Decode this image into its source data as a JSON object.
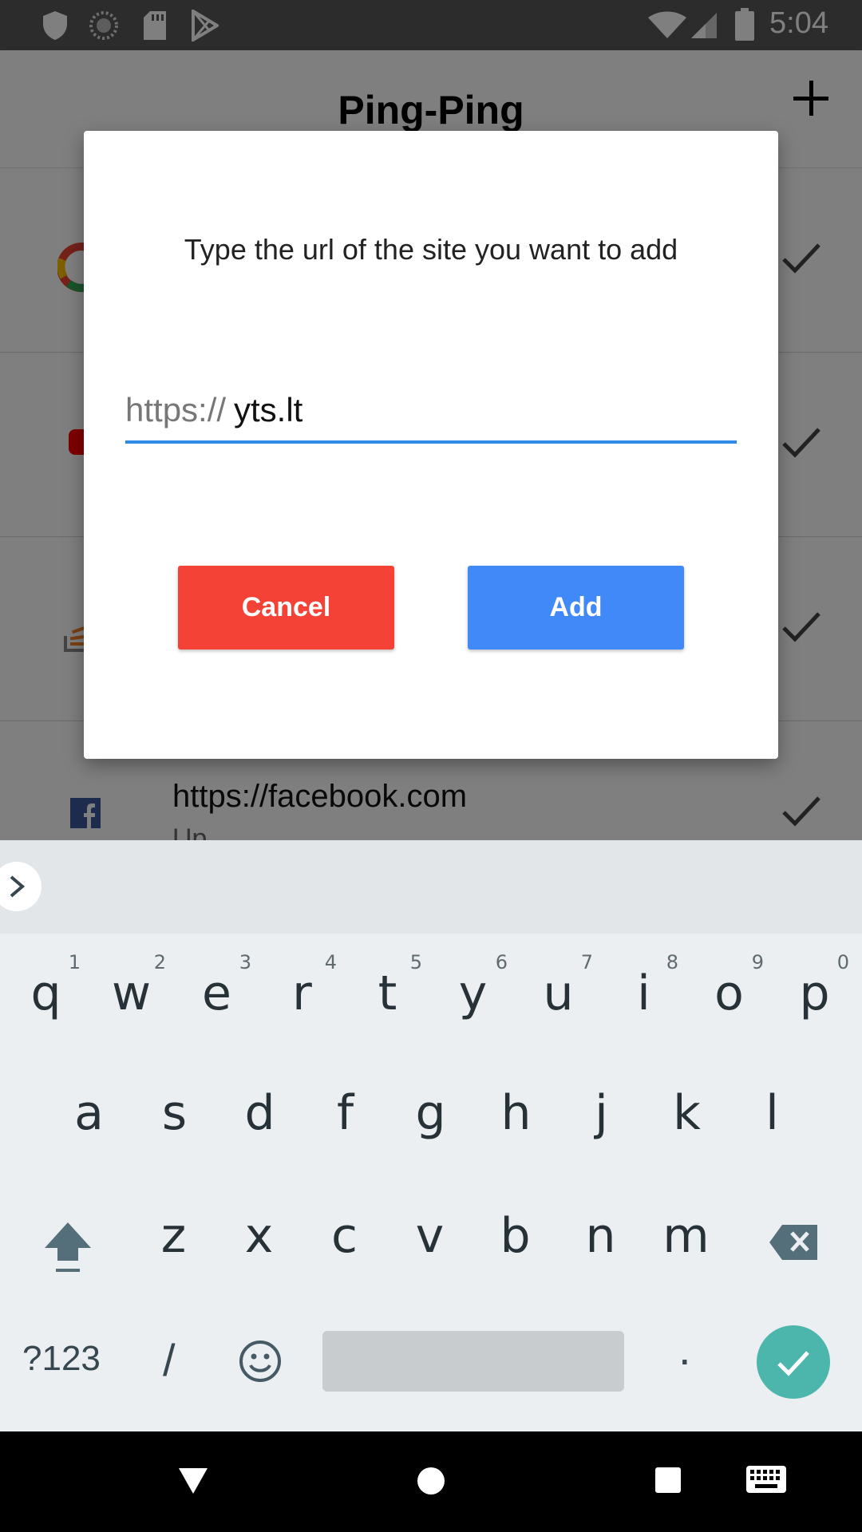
{
  "status_bar": {
    "time": "5:04",
    "left_icons": [
      "shield-icon",
      "sync-icon",
      "sd-card-icon",
      "play-store-icon"
    ],
    "right_icons": [
      "wifi-icon",
      "cell-signal-icon",
      "battery-icon"
    ]
  },
  "app": {
    "title": "Ping-Ping",
    "add_icon": "plus-icon",
    "sites": [
      {
        "url": "",
        "status": "",
        "favicon": "google-favicon",
        "check_icon": "check-icon"
      },
      {
        "url": "",
        "status": "",
        "favicon": "youtube-favicon",
        "check_icon": "check-icon"
      },
      {
        "url": "",
        "status": "",
        "favicon": "stackoverflow-favicon",
        "check_icon": "check-icon"
      },
      {
        "url": "https://facebook.com",
        "status": "Up",
        "favicon": "facebook-favicon",
        "check_icon": "check-icon"
      }
    ]
  },
  "dialog": {
    "message": "Type the url of the site you want to add",
    "url_prefix": "https://",
    "url_value": "yts.lt",
    "cancel_label": "Cancel",
    "add_label": "Add",
    "cancel_color": "#f44336",
    "add_color": "#4189f8",
    "input_underline_color": "#2f8be6"
  },
  "keyboard": {
    "row1": [
      {
        "letter": "q",
        "hint": "1"
      },
      {
        "letter": "w",
        "hint": "2"
      },
      {
        "letter": "e",
        "hint": "3"
      },
      {
        "letter": "r",
        "hint": "4"
      },
      {
        "letter": "t",
        "hint": "5"
      },
      {
        "letter": "y",
        "hint": "6"
      },
      {
        "letter": "u",
        "hint": "7"
      },
      {
        "letter": "i",
        "hint": "8"
      },
      {
        "letter": "o",
        "hint": "9"
      },
      {
        "letter": "p",
        "hint": "0"
      }
    ],
    "row2": [
      "a",
      "s",
      "d",
      "f",
      "g",
      "h",
      "j",
      "k",
      "l"
    ],
    "row3": [
      "z",
      "x",
      "c",
      "v",
      "b",
      "n",
      "m"
    ],
    "symbols_label": "?123",
    "slash_label": "/",
    "period_label": ".",
    "done_color": "#4db6ac"
  },
  "nav_bar": {
    "icons": [
      "back-icon",
      "home-icon",
      "recents-icon",
      "keyboard-switch-icon"
    ]
  }
}
